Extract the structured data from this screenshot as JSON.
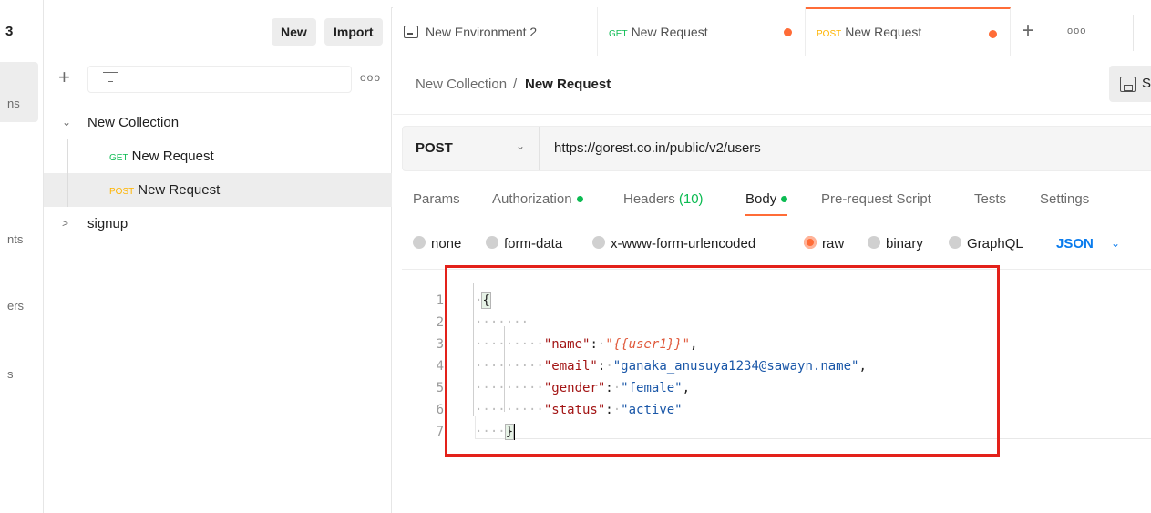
{
  "nav": {
    "workspace_fragment": "3",
    "items": [
      {
        "label": "ns",
        "active": true
      },
      {
        "label": "nts"
      },
      {
        "label": "ers"
      },
      {
        "label": "s"
      }
    ]
  },
  "sidebar": {
    "new_label": "New",
    "import_label": "Import",
    "tree": {
      "collection": "New Collection",
      "requests": [
        {
          "method": "GET",
          "name": "New Request"
        },
        {
          "method": "POST",
          "name": "New Request",
          "selected": true
        }
      ],
      "folder": "signup"
    }
  },
  "tabs": [
    {
      "kind": "env",
      "label": "New Environment 2"
    },
    {
      "method": "GET",
      "label": "New Request",
      "unsaved": true
    },
    {
      "method": "POST",
      "label": "New Request",
      "unsaved": true,
      "active": true
    }
  ],
  "breadcrumb": {
    "collection": "New Collection",
    "separator": "/",
    "request": "New Request",
    "save_fragment": "S"
  },
  "request": {
    "method": "POST",
    "url": "https://gorest.co.in/public/v2/users"
  },
  "request_tabs": [
    {
      "label": "Params"
    },
    {
      "label": "Authorization",
      "dot": true
    },
    {
      "label": "Headers",
      "count": "(10)"
    },
    {
      "label": "Body",
      "dot": true,
      "active": true
    },
    {
      "label": "Pre-request Script"
    },
    {
      "label": "Tests"
    },
    {
      "label": "Settings"
    }
  ],
  "body_options": {
    "options": [
      "none",
      "form-data",
      "x-www-form-urlencoded",
      "raw",
      "binary",
      "GraphQL"
    ],
    "selected": "raw",
    "format": "JSON"
  },
  "editor": {
    "line_numbers": [
      "1",
      "2",
      "3",
      "4",
      "5",
      "6",
      "7"
    ],
    "lines": [
      {
        "open": "{"
      },
      {
        "blank": ""
      },
      {
        "key": "\"name\"",
        "colon": ":",
        "value": "\"{{user1}}\"",
        "trail": ","
      },
      {
        "key": "\"email\"",
        "colon": ":",
        "value": "\"ganaka_anusuya1234@sawayn.name\"",
        "trail": ","
      },
      {
        "key": "\"gender\"",
        "colon": ":",
        "value": "\"female\"",
        "trail": ","
      },
      {
        "key": "\"status\"",
        "colon": ":",
        "value": "\"active\"",
        "trail": ""
      },
      {
        "close": "}"
      }
    ]
  },
  "colors": {
    "accent": "#ff6c37",
    "get": "#0cbb52",
    "post": "#ffb400",
    "link": "#097bed",
    "highlight_box": "#e3211a"
  }
}
